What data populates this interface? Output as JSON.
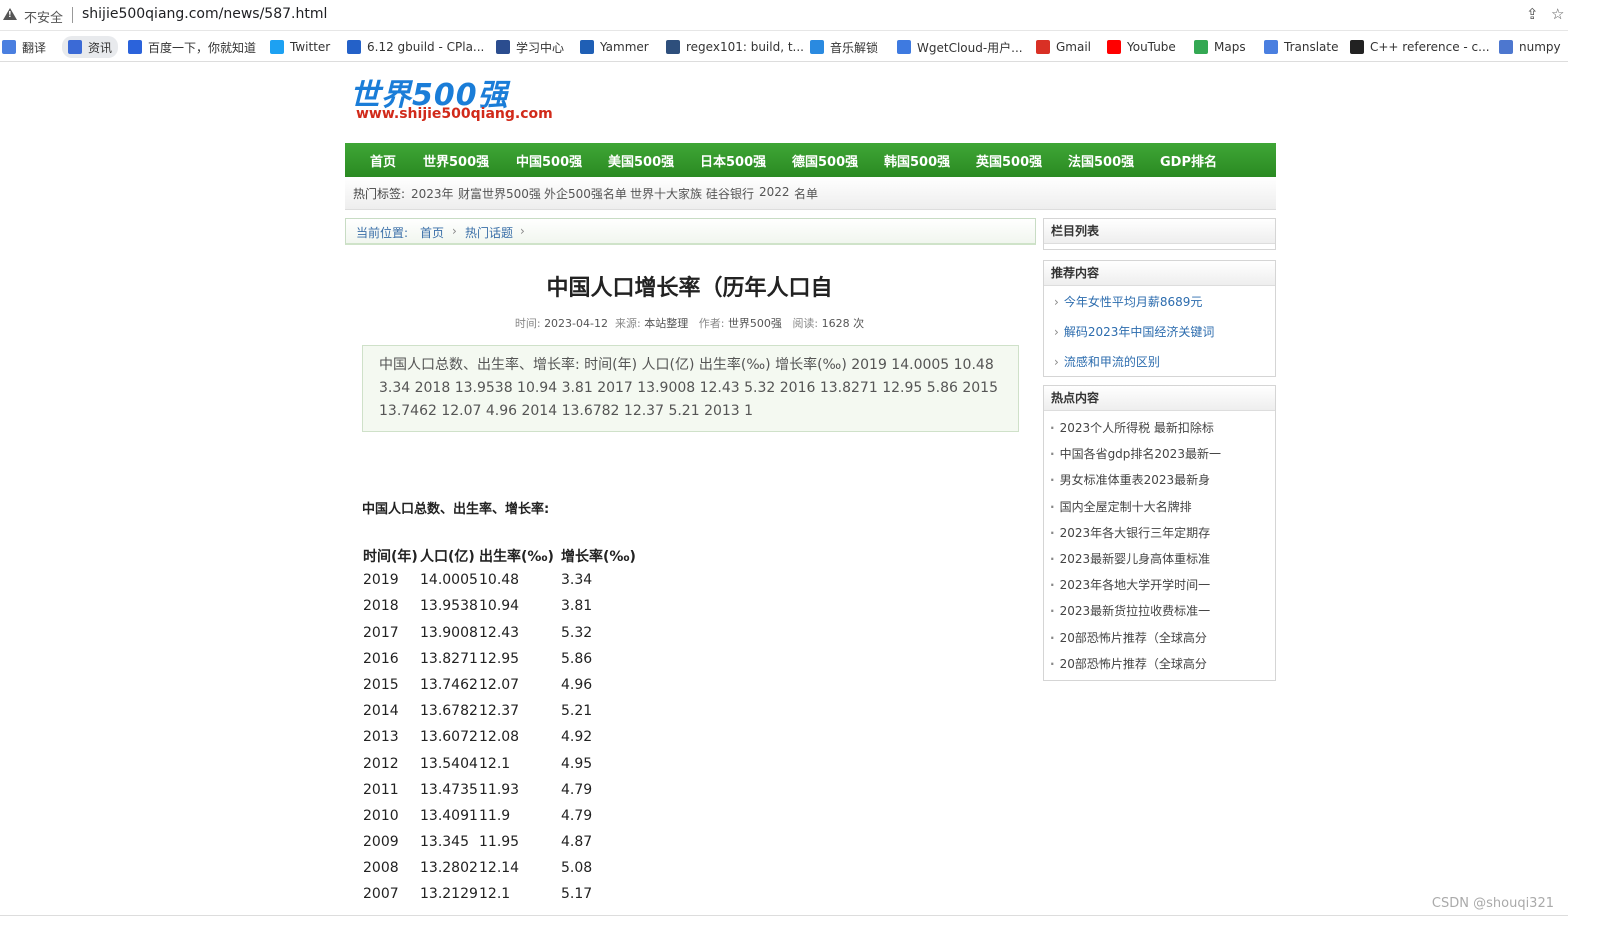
{
  "browser": {
    "insecure_label": "不安全",
    "url": "shijie500qiang.com/news/587.html",
    "share_icon": "share-icon",
    "bookmark_icon": "star-icon"
  },
  "bookmarks": [
    {
      "label": "翻译",
      "icon": "translate-icon",
      "color": "#4a7fe0"
    },
    {
      "label": "资讯",
      "icon": "news-icon",
      "color": "#3b6ad6"
    },
    {
      "label": "百度一下，你就知道",
      "icon": "baidu-icon",
      "color": "#2b63db"
    },
    {
      "label": "Twitter",
      "icon": "twitter-icon",
      "color": "#1da1f2"
    },
    {
      "label": "6.12 gbuild - CPla...",
      "icon": "confluence-icon",
      "color": "#2461c8"
    },
    {
      "label": "学习中心",
      "icon": "notion-icon",
      "color": "#2b4d8f"
    },
    {
      "label": "Yammer",
      "icon": "yammer-icon",
      "color": "#1f5fb5"
    },
    {
      "label": "regex101: build, t...",
      "icon": "regex-icon",
      "color": "#2e4f7c"
    },
    {
      "label": "音乐解锁",
      "icon": "music-icon",
      "color": "#2a8ae0"
    },
    {
      "label": "WgetCloud-用户...",
      "icon": "wget-icon",
      "color": "#3e7ae0"
    },
    {
      "label": "Gmail",
      "icon": "gmail-icon",
      "color": "#d93025"
    },
    {
      "label": "YouTube",
      "icon": "youtube-icon",
      "color": "#ff0000"
    },
    {
      "label": "Maps",
      "icon": "maps-icon",
      "color": "#34a853"
    },
    {
      "label": "Translate",
      "icon": "translate-icon",
      "color": "#4a7fe0"
    },
    {
      "label": "C++ reference - c...",
      "icon": "cpp-icon",
      "color": "#222222"
    },
    {
      "label": "numpy",
      "icon": "numpy-icon",
      "color": "#4d77cf"
    }
  ],
  "site": {
    "logo_text": "世界500强",
    "logo_url": "www.shijie500qiang.com",
    "nav": [
      "首页",
      "世界500强",
      "中国500强",
      "美国500强",
      "日本500强",
      "德国500强",
      "韩国500强",
      "英国500强",
      "法国500强",
      "GDP排名"
    ],
    "hot_tags_label": "热门标签:",
    "hot_tags": [
      "2023年",
      "财富世界500强",
      "外企500强名单",
      "世界十大家族",
      "硅谷银行",
      "2022",
      "名单"
    ]
  },
  "breadcrumb": {
    "label": "当前位置:",
    "items": [
      "首页",
      "热门话题"
    ]
  },
  "article": {
    "title": "中国人口增长率（历年人口自",
    "meta": {
      "time_label": "时间:",
      "time": "2023-04-12",
      "source_label": "来源:",
      "source": "本站整理",
      "author_label": "作者:",
      "author": "世界500强",
      "reads_label": "阅读:",
      "reads": "1628 次"
    },
    "summary": "中国人口总数、出生率、增长率: 时间(年) 人口(亿) 出生率(‰) 增长率(‰) 2019 14.0005 10.48 3.34 2018 13.9538 10.94 3.81 2017 13.9008 12.43 5.32 2016 13.8271 12.95 5.86 2015 13.7462 12.07 4.96 2014 13.6782 12.37 5.21 2013 1",
    "section_heading": "中国人口总数、出生率、增长率:",
    "table": {
      "headers": [
        "时间(年)",
        "人口(亿)",
        "出生率(‰)",
        "增长率(‰)"
      ],
      "rows": [
        [
          "2019",
          "14.0005",
          "10.48",
          "3.34"
        ],
        [
          "2018",
          "13.9538",
          "10.94",
          "3.81"
        ],
        [
          "2017",
          "13.9008",
          "12.43",
          "5.32"
        ],
        [
          "2016",
          "13.8271",
          "12.95",
          "5.86"
        ],
        [
          "2015",
          "13.7462",
          "12.07",
          "4.96"
        ],
        [
          "2014",
          "13.6782",
          "12.37",
          "5.21"
        ],
        [
          "2013",
          "13.6072",
          "12.08",
          "4.92"
        ],
        [
          "2012",
          "13.5404",
          "12.1",
          "4.95"
        ],
        [
          "2011",
          "13.4735",
          "11.93",
          "4.79"
        ],
        [
          "2010",
          "13.4091",
          "11.9",
          "4.79"
        ],
        [
          "2009",
          "13.345",
          "11.95",
          "4.87"
        ],
        [
          "2008",
          "13.2802",
          "12.14",
          "5.08"
        ],
        [
          "2007",
          "13.2129",
          "12.1",
          "5.17"
        ]
      ]
    }
  },
  "sidebar": {
    "column_list_title": "栏目列表",
    "recommend_title": "推荐内容",
    "recommend_items": [
      "今年女性平均月薪8689元",
      "解码2023年中国经济关键词",
      "流感和甲流的区别"
    ],
    "hot_title": "热点内容",
    "hot_items": [
      "2023个人所得税 最新扣除标",
      "中国各省gdp排名2023最新一",
      "男女标准体重表2023最新身",
      "国内全屋定制十大名牌排",
      "2023年各大银行三年定期存",
      "2023最新婴儿身高体重标准",
      "2023年各地大学开学时间一",
      "2023最新货拉拉收费标准一",
      "20部恐怖片推荐（全球高分",
      "20部恐怖片推荐（全球高分"
    ]
  },
  "watermark": "CSDN @shouqi321"
}
